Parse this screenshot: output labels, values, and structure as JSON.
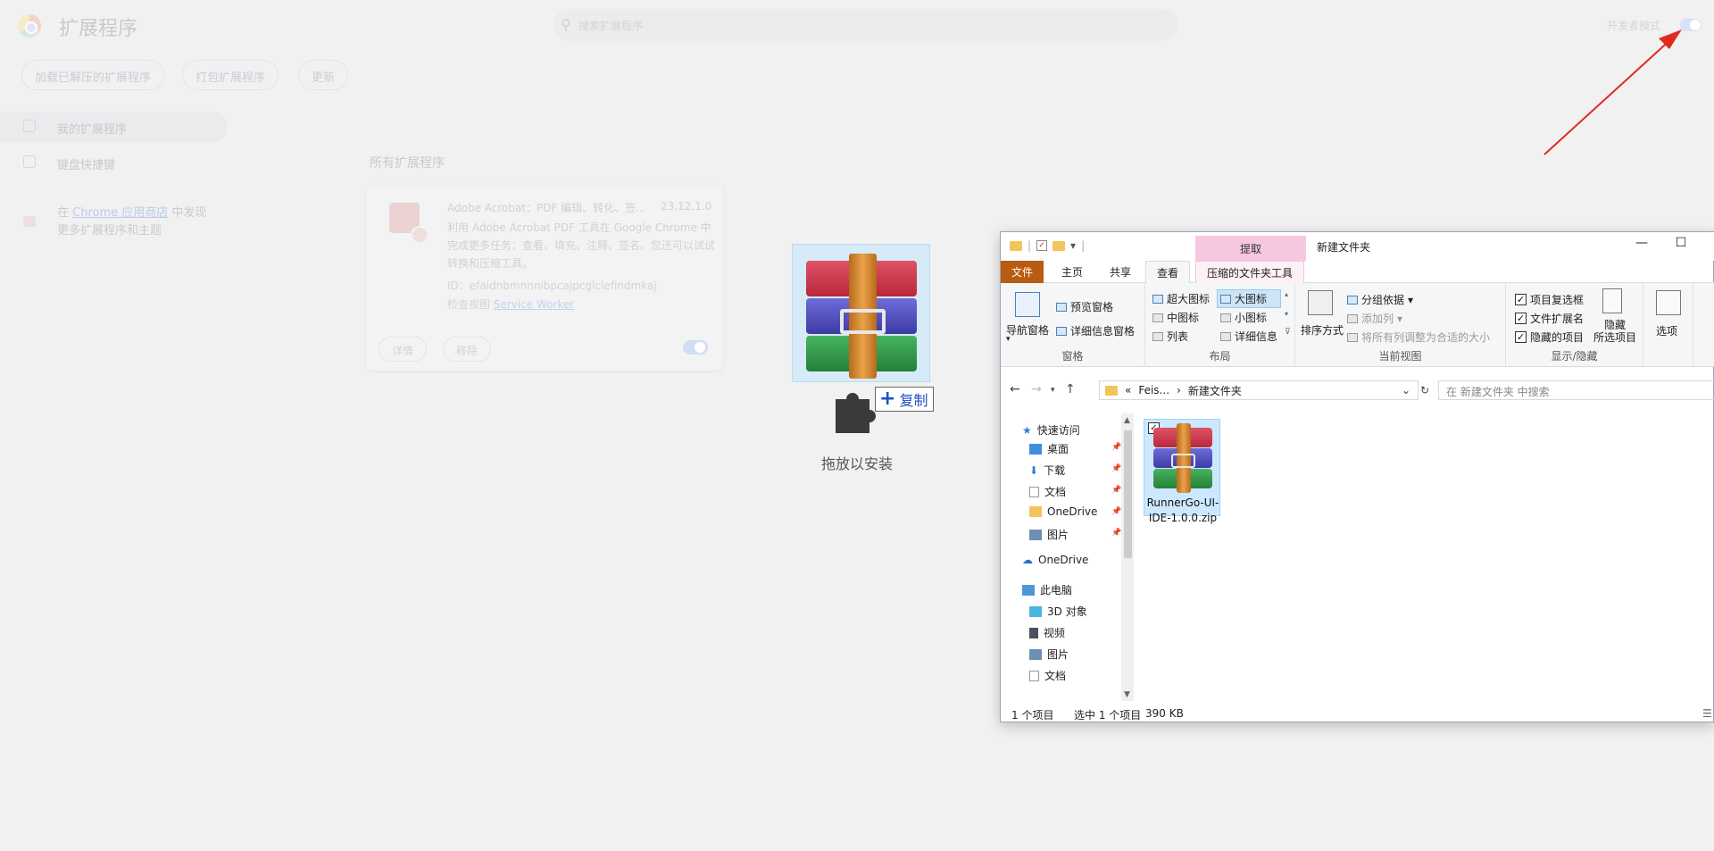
{
  "chrome": {
    "title": "扩展程序",
    "search_placeholder": "搜索扩展程序",
    "dev_mode_label": "开发者模式",
    "buttons": [
      "加载已解压的扩展程序",
      "打包扩展程序",
      "更新"
    ],
    "nav": [
      {
        "label": "我的扩展程序",
        "icon": "puzzle-icon"
      },
      {
        "label": "键盘快捷键",
        "icon": "keyboard-icon"
      }
    ],
    "store_prefix": "在",
    "store_link": "Chrome 应用商店",
    "store_suffix": "中发现更多扩展程序和主题",
    "section_title": "所有扩展程序",
    "extension": {
      "name": "Adobe Acrobat：PDF 编辑、转化、签...",
      "version": "23.12.1.0",
      "description": "利用 Adobe Acrobat PDF 工具在 Google Chrome 中完成更多任务：查看、填充、注释、签名。您还可以试试转换和压缩工具。",
      "id_text": "ID：efaidnbmnnnibpcajpcglclefindmkaj",
      "inspect_prefix": "检查视图",
      "inspect_link": "Service Worker",
      "details_button": "详情",
      "remove_button": "移除"
    }
  },
  "drag": {
    "copy_label": "复制",
    "drop_label": "拖放以安装"
  },
  "explorer": {
    "context_tab": "提取",
    "window_title": "新建文件夹",
    "tabs": [
      "文件",
      "主页",
      "共享",
      "查看",
      "压缩的文件夹工具"
    ],
    "active_tab": "查看",
    "panes": {
      "nav_pane": "导航窗格",
      "preview_pane": "预览窗格",
      "details_pane": "详细信息窗格",
      "label": "窗格"
    },
    "layout": {
      "items": [
        "超大图标",
        "大图标",
        "中图标",
        "小图标",
        "列表",
        "详细信息"
      ],
      "selected": "大图标",
      "label": "布局"
    },
    "current_view": {
      "sort_by": "排序方式",
      "group_by": "分组依据",
      "add_column": "添加列",
      "fit_columns": "将所有列调整为合适的大小",
      "label": "当前视图"
    },
    "show_hide": {
      "item_checkboxes": "项目复选框",
      "file_extensions": "文件扩展名",
      "hidden_items": "隐藏的项目",
      "hide_selected_1": "隐藏",
      "hide_selected_2": "所选项目",
      "label": "显示/隐藏"
    },
    "options": "选项",
    "breadcrumb": [
      "«",
      "Feis...",
      "›",
      "新建文件夹"
    ],
    "search_placeholder": "在 新建文件夹 中搜索",
    "nav_items": [
      {
        "label": "快速访问",
        "icon": "star-icon",
        "pinned": false
      },
      {
        "label": "桌面",
        "icon": "desktop-icon",
        "pinned": true
      },
      {
        "label": "下载",
        "icon": "download-icon",
        "pinned": true
      },
      {
        "label": "文档",
        "icon": "document-icon",
        "pinned": true
      },
      {
        "label": "OneDrive",
        "icon": "onedrive-folder-icon",
        "pinned": true
      },
      {
        "label": "图片",
        "icon": "pictures-icon",
        "pinned": true
      },
      {
        "label": "OneDrive",
        "icon": "cloud-icon",
        "pinned": false
      },
      {
        "label": "此电脑",
        "icon": "computer-icon",
        "pinned": false
      },
      {
        "label": "3D 对象",
        "icon": "cube-icon",
        "pinned": false
      },
      {
        "label": "视频",
        "icon": "video-icon",
        "pinned": false
      },
      {
        "label": "图片",
        "icon": "pictures-icon",
        "pinned": false
      },
      {
        "label": "文档",
        "icon": "document-icon",
        "pinned": false
      }
    ],
    "file": {
      "name": "RunnerGo-UI-IDE-1.0.0.zip",
      "checked": true
    },
    "status": {
      "count": "1 个项目",
      "selected": "选中 1 个项目",
      "size": "390 KB"
    }
  },
  "colors": {
    "file_tab": "#b85c12",
    "context_tab": "#f7c7df",
    "selection": "#cce8ff",
    "arrow": "#e02a1f",
    "copy_text": "#1f4fc4"
  }
}
